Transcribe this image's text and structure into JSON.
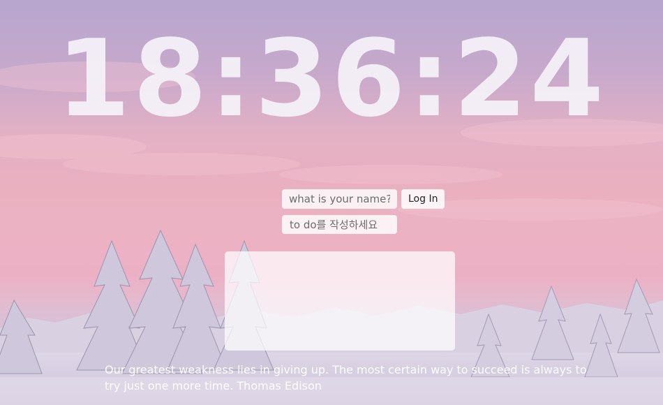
{
  "clock": {
    "time": "18:36:24"
  },
  "login": {
    "name_placeholder": "what is your name?",
    "button_label": "Log In"
  },
  "todo": {
    "placeholder": "to do를 작성하세요",
    "items": []
  },
  "quote": {
    "text": "Our greatest weakness lies in giving up. The most certain way to succeed is always to try just one more time.",
    "author": "Thomas Edison"
  },
  "background": {
    "sky_top": "#b7a6cf",
    "sky_mid": "#eab0c0",
    "snow": "#e6e1ee",
    "tree_shadow": "#8f879f"
  }
}
